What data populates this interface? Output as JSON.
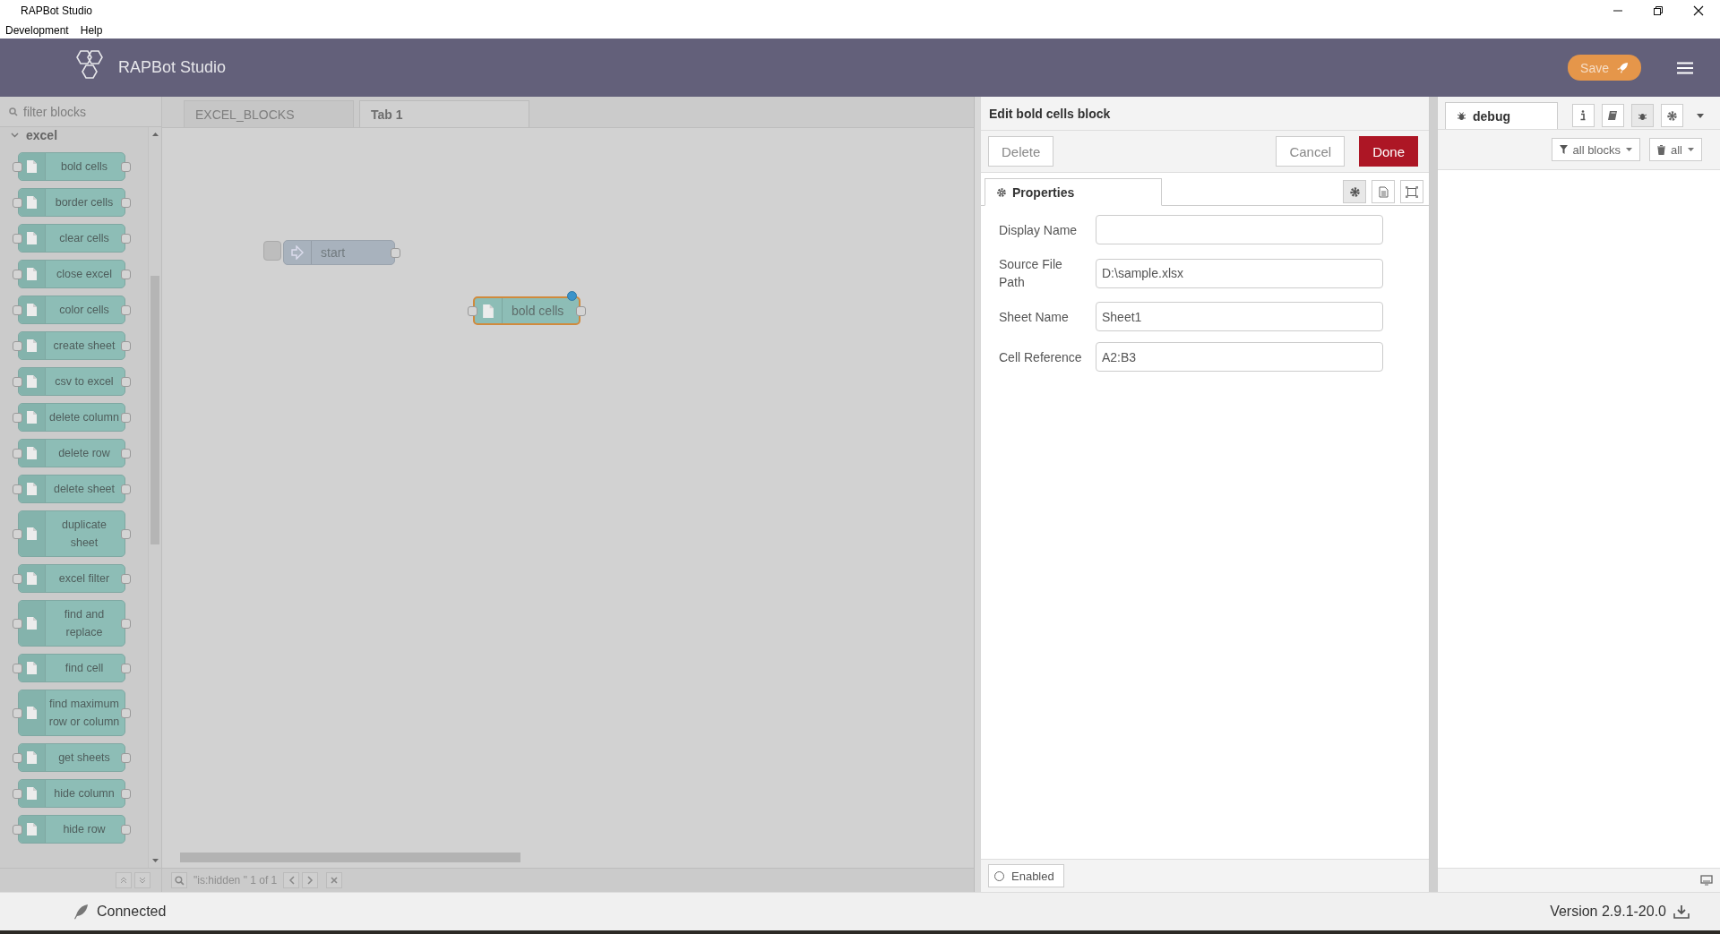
{
  "window": {
    "title": "RAPBot Studio"
  },
  "menu": [
    "Development",
    "Help"
  ],
  "header": {
    "title": "RAPBot Studio",
    "save_button": "Save"
  },
  "palette": {
    "search": {
      "placeholder": "filter blocks"
    },
    "category": {
      "label": "excel",
      "expanded": true
    },
    "blocks": [
      {
        "label": "bold cells"
      },
      {
        "label": "border cells"
      },
      {
        "label": "clear cells"
      },
      {
        "label": "close excel"
      },
      {
        "label": "color cells"
      },
      {
        "label": "create sheet"
      },
      {
        "label": "csv to excel"
      },
      {
        "label": "delete column"
      },
      {
        "label": "delete row"
      },
      {
        "label": "delete sheet"
      },
      {
        "label": "duplicate sheet"
      },
      {
        "label": "excel filter"
      },
      {
        "label": "find and replace"
      },
      {
        "label": "find cell"
      },
      {
        "label": "find maximum row or column"
      },
      {
        "label": "get sheets"
      },
      {
        "label": "hide column"
      },
      {
        "label": "hide row"
      }
    ]
  },
  "tabs": [
    {
      "label": "EXCEL_BLOCKS",
      "selected": false
    },
    {
      "label": "Tab 1",
      "selected": true
    }
  ],
  "canvas": {
    "nodes": [
      {
        "kind": "inject",
        "label": "start",
        "selected": false,
        "changed": false
      },
      {
        "kind": "function",
        "label": "bold cells",
        "selected": true,
        "changed": true
      }
    ],
    "search": {
      "text": "\"is:hidden \" 1 of 1"
    }
  },
  "editor": {
    "title": "Edit bold cells block",
    "delete_button": "Delete",
    "cancel_button": "Cancel",
    "done_button": "Done",
    "tab": "Properties",
    "fields": [
      {
        "label": "Display Name"
      },
      {
        "label": "Source File Path",
        "value": "D:\\sample.xlsx"
      },
      {
        "label": "Sheet Name",
        "value": "Sheet1"
      },
      {
        "label": "Cell Reference",
        "value": "A2:B3"
      }
    ],
    "enabled": {
      "label": "Enabled",
      "on": false
    }
  },
  "sidebar": {
    "tab": "debug",
    "filter": "all blocks",
    "clear": "all"
  },
  "status_bar": {
    "connection": "Connected",
    "version": "Version 2.9.1-20.0"
  }
}
